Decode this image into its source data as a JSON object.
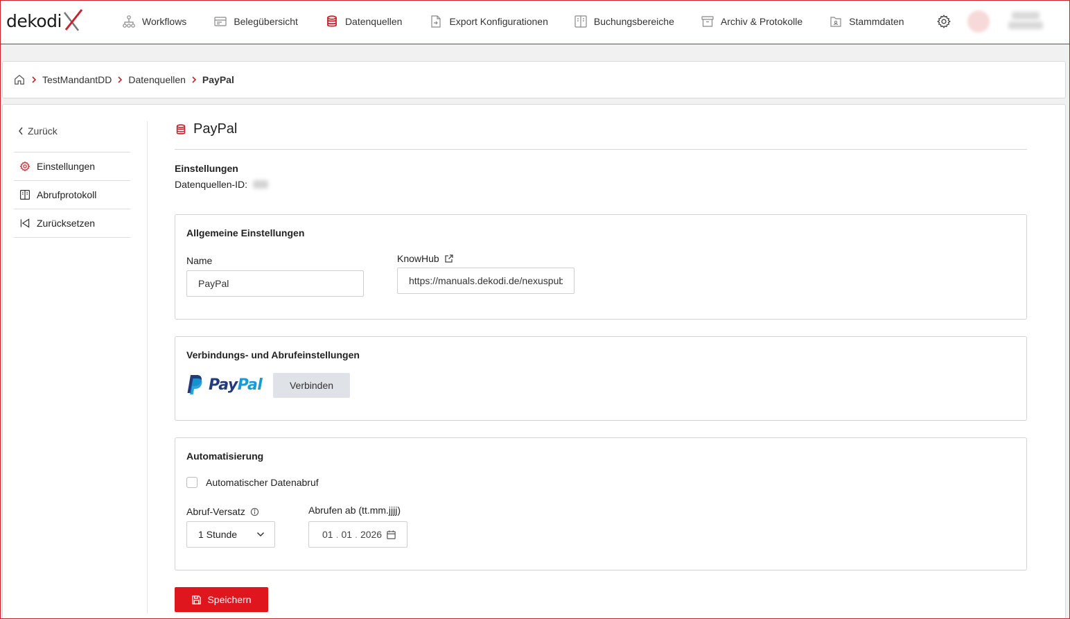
{
  "app": {
    "logo_text": "dekodi"
  },
  "nav": {
    "items": [
      {
        "label": "Workflows"
      },
      {
        "label": "Belegübersicht"
      },
      {
        "label": "Datenquellen"
      },
      {
        "label": "Export Konfigurationen"
      },
      {
        "label": "Buchungsbereiche"
      },
      {
        "label": "Archiv & Protokolle"
      },
      {
        "label": "Stammdaten"
      }
    ],
    "active": "Datenquellen"
  },
  "breadcrumb": {
    "items": [
      "TestMandantDD",
      "Datenquellen",
      "PayPal"
    ]
  },
  "sidebar": {
    "back_label": "Zurück",
    "items": [
      {
        "label": "Einstellungen"
      },
      {
        "label": "Abrufprotokoll"
      },
      {
        "label": "Zurücksetzen"
      }
    ]
  },
  "page": {
    "title": "PayPal",
    "section_title": "Einstellungen",
    "id_label": "Datenquellen-ID:"
  },
  "general": {
    "heading": "Allgemeine Einstellungen",
    "name_label": "Name",
    "name_value": "PayPal",
    "knowhub_label": "KnowHub",
    "knowhub_value": "https://manuals.dekodi.de/nexuspub"
  },
  "connection": {
    "heading": "Verbindungs- und Abrufeinstellungen",
    "logo_text_1": "Pay",
    "logo_text_2": "Pal",
    "connect_label": "Verbinden"
  },
  "automation": {
    "heading": "Automatisierung",
    "checkbox_label": "Automatischer Datenabruf",
    "interval_label": "Abruf-Versatz",
    "interval_value": "1 Stunde",
    "date_label": "Abrufen ab (tt.mm.jjjj)",
    "date_day": "01",
    "date_month": "01",
    "date_year": "2026"
  },
  "actions": {
    "save_label": "Speichern"
  },
  "colors": {
    "accent": "#e0161e",
    "paypal_dark": "#233a7d",
    "paypal_light": "#179bd7"
  }
}
